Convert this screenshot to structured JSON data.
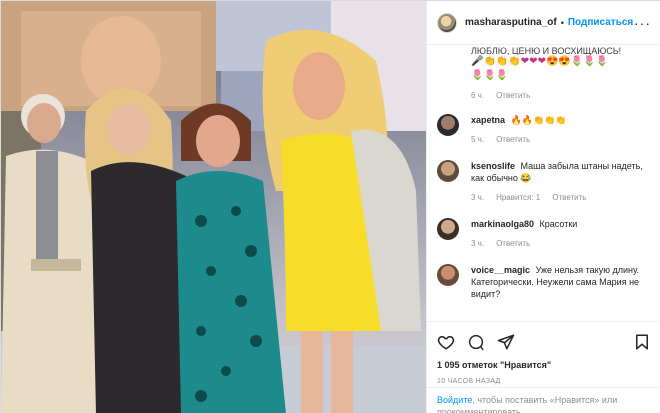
{
  "post": {
    "username": "masharasputina_of",
    "separator": "•",
    "follow_label": "Подписаться",
    "more_label": "···"
  },
  "comments_top": {
    "partial_text": "ЛЮБЛЮ, ЦЕНЮ И ВОСХИЩАЮСЬ!",
    "emoji": "🎤👏👏👏❤❤❤😍😍🌷🌷🌷",
    "tail": "🌷🌷🌷",
    "time": "6 ч.",
    "reply": "Ответить"
  },
  "comments": [
    {
      "user": "xapetna",
      "text": "🔥🔥👏👏👏",
      "time": "5 ч.",
      "likes": "",
      "reply": "Ответить",
      "avatar": "#2b2b2b"
    },
    {
      "user": "ksenoslife",
      "text": "Маша забыла штаны надеть, как обычно 😂",
      "time": "3 ч.",
      "likes": "Нравится: 1",
      "reply": "Ответить",
      "avatar": "#5b4b3a"
    },
    {
      "user": "markinaolga80",
      "text": "Красотки",
      "time": "3 ч.",
      "likes": "",
      "reply": "Ответить",
      "avatar": "#3a2e28"
    },
    {
      "user": "voice__magic",
      "text": "Уже нельзя такую длину. Категорически. Неужели сама Мария не видит?",
      "time": "",
      "likes": "",
      "reply": "",
      "avatar": "#6a4a38"
    }
  ],
  "actions": {
    "likes": "1 095 отметок \"Нравится\"",
    "time_ago": "10 ЧАСОВ НАЗАД"
  },
  "login": {
    "link": "Войдите",
    "text": ", чтобы поставить «Нравится» или прокомментировать"
  },
  "colors": {
    "accent": "#0095f6",
    "secondary_text": "#8e8e8e",
    "border": "#efefef"
  }
}
